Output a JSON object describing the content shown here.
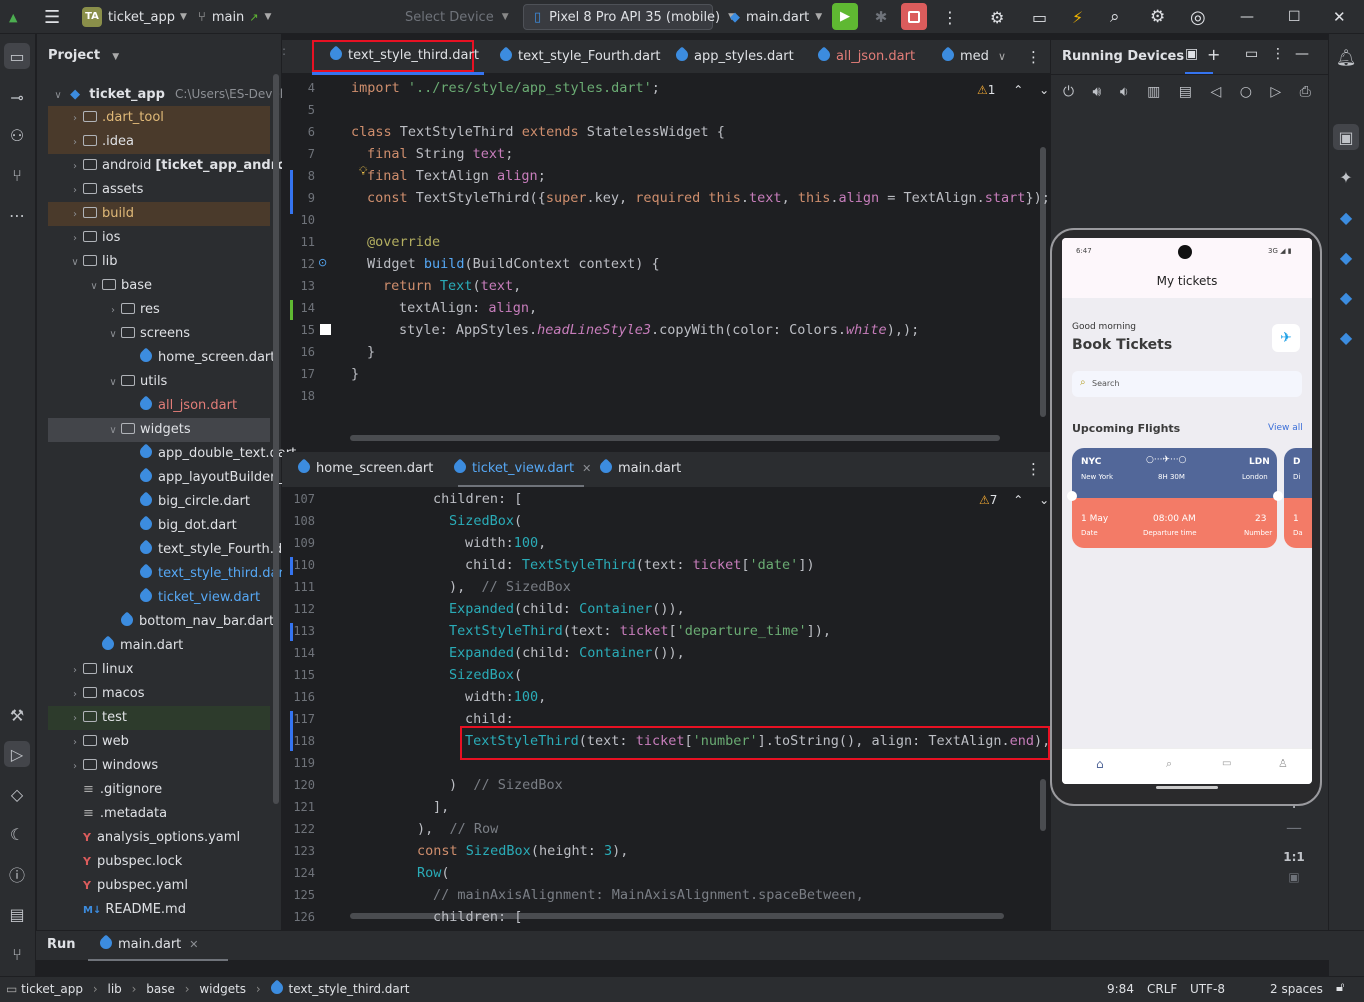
{
  "titlebar": {
    "project_badge": "TA",
    "project_name": "ticket_app",
    "branch": "main",
    "select_device": "Select Device",
    "device": "Pixel 8 Pro API 35 (mobile)",
    "run_config": "main.dart"
  },
  "project_panel": {
    "title": "Project",
    "root": "ticket_app",
    "root_path": "C:\\Users\\ES-Developer",
    "items": [
      {
        "label": ".dart_tool",
        "depth": 1,
        "arrow": ">",
        "type": "folder"
      },
      {
        "label": ".idea",
        "depth": 1,
        "arrow": ">",
        "type": "folder"
      },
      {
        "label": "android",
        "suffix": "[ticket_app_android]",
        "depth": 1,
        "arrow": ">",
        "type": "folder"
      },
      {
        "label": "assets",
        "depth": 1,
        "arrow": ">",
        "type": "folder"
      },
      {
        "label": "build",
        "depth": 1,
        "arrow": ">",
        "type": "folder"
      },
      {
        "label": "ios",
        "depth": 1,
        "arrow": ">",
        "type": "folder"
      },
      {
        "label": "lib",
        "depth": 1,
        "arrow": "v",
        "type": "folder"
      },
      {
        "label": "base",
        "depth": 2,
        "arrow": "v",
        "type": "folder"
      },
      {
        "label": "res",
        "depth": 3,
        "arrow": ">",
        "type": "folder"
      },
      {
        "label": "screens",
        "depth": 3,
        "arrow": "v",
        "type": "folder"
      },
      {
        "label": "home_screen.dart",
        "depth": 4,
        "arrow": "",
        "type": "dart"
      },
      {
        "label": "utils",
        "depth": 3,
        "arrow": "v",
        "type": "folder"
      },
      {
        "label": "all_json.dart",
        "depth": 4,
        "arrow": "",
        "type": "dart"
      },
      {
        "label": "widgets",
        "depth": 3,
        "arrow": "v",
        "type": "folder"
      },
      {
        "label": "app_double_text.dart",
        "depth": 4,
        "arrow": "",
        "type": "dart"
      },
      {
        "label": "app_layoutBuilder_wid",
        "depth": 4,
        "arrow": "",
        "type": "dart"
      },
      {
        "label": "big_circle.dart",
        "depth": 4,
        "arrow": "",
        "type": "dart"
      },
      {
        "label": "big_dot.dart",
        "depth": 4,
        "arrow": "",
        "type": "dart"
      },
      {
        "label": "text_style_Fourth.dart",
        "depth": 4,
        "arrow": "",
        "type": "dart"
      },
      {
        "label": "text_style_third.dart",
        "depth": 4,
        "arrow": "",
        "type": "dart"
      },
      {
        "label": "ticket_view.dart",
        "depth": 4,
        "arrow": "",
        "type": "dart"
      },
      {
        "label": "bottom_nav_bar.dart",
        "depth": 3,
        "arrow": "",
        "type": "dart"
      },
      {
        "label": "main.dart",
        "depth": 2,
        "arrow": "",
        "type": "dart"
      },
      {
        "label": "linux",
        "depth": 1,
        "arrow": ">",
        "type": "folder"
      },
      {
        "label": "macos",
        "depth": 1,
        "arrow": ">",
        "type": "folder"
      },
      {
        "label": "test",
        "depth": 1,
        "arrow": ">",
        "type": "folder"
      },
      {
        "label": "web",
        "depth": 1,
        "arrow": ">",
        "type": "folder"
      },
      {
        "label": "windows",
        "depth": 1,
        "arrow": ">",
        "type": "folder"
      },
      {
        "label": ".gitignore",
        "depth": 1,
        "arrow": "",
        "type": "file"
      },
      {
        "label": ".metadata",
        "depth": 1,
        "arrow": "",
        "type": "file"
      },
      {
        "label": "analysis_options.yaml",
        "depth": 1,
        "arrow": "",
        "type": "yaml"
      },
      {
        "label": "pubspec.lock",
        "depth": 1,
        "arrow": "",
        "type": "yaml"
      },
      {
        "label": "pubspec.yaml",
        "depth": 1,
        "arrow": "",
        "type": "yaml"
      },
      {
        "label": "README.md",
        "depth": 1,
        "arrow": "",
        "type": "md"
      }
    ]
  },
  "top_editor": {
    "tabs": [
      "text_style_third.dart",
      "text_style_Fourth.dart",
      "app_styles.dart",
      "all_json.dart",
      "med"
    ],
    "warning_count": "1",
    "line_numbers": [
      "4",
      "5",
      "6",
      "7",
      "8",
      "9",
      "10",
      "11",
      "12",
      "13",
      "14",
      "15",
      "16",
      "17",
      "18"
    ]
  },
  "bottom_editor": {
    "tabs": [
      "home_screen.dart",
      "ticket_view.dart",
      "main.dart"
    ],
    "warning_count": "7",
    "line_numbers": [
      "107",
      "108",
      "109",
      "110",
      "111",
      "112",
      "113",
      "114",
      "115",
      "116",
      "117",
      "118",
      "119",
      "120",
      "121",
      "122",
      "123",
      "124",
      "125",
      "126"
    ]
  },
  "running_devices": {
    "title": "Running Devices",
    "zoom": "1:1"
  },
  "phone_app": {
    "time": "6:47",
    "signal": "3G",
    "header": "My tickets",
    "greeting": "Good morning",
    "title": "Book Tickets",
    "search_placeholder": "Search",
    "section": "Upcoming Flights",
    "view_all": "View all",
    "ticket": {
      "from_code": "NYC",
      "from_name": "New York",
      "duration": "8H 30M",
      "to_code": "LDN",
      "to_name": "London",
      "date": "1 May",
      "date_label": "Date",
      "departure_time": "08:00 AM",
      "departure_label": "Departure time",
      "number": "23",
      "number_label": "Number"
    },
    "second_ticket_codes": [
      "D",
      "Di",
      "1",
      "Da"
    ]
  },
  "bottom_panel": {
    "run_tab": "Run",
    "file_tab": "main.dart"
  },
  "status": {
    "breadcrumbs": [
      "ticket_app",
      "lib",
      "base",
      "widgets",
      "text_style_third.dart"
    ],
    "position": "9:84",
    "line_sep": "CRLF",
    "encoding": "UTF-8",
    "indent": "2 spaces"
  },
  "colors": {
    "accent": "#3574f0",
    "highlight": "#e81123",
    "run_green": "#5fb832",
    "stop_red": "#db5c5c",
    "ticket_blue": "#526799",
    "ticket_coral": "#f37b67"
  }
}
